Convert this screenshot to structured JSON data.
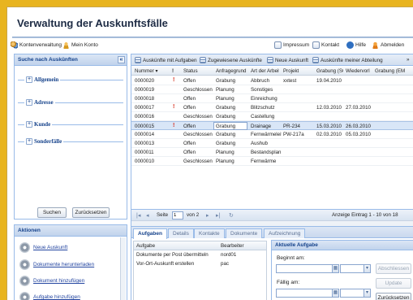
{
  "app": {
    "title": "Verwaltung der Auskunftsfälle"
  },
  "topbar": {
    "left": [
      {
        "label": "Kontenverwaltung",
        "icon": "users-icon"
      },
      {
        "label": "Mein Konto",
        "icon": "user-icon"
      }
    ],
    "right": [
      {
        "label": "Impressum",
        "icon": "document-icon"
      },
      {
        "label": "Kontakt",
        "icon": "contact-icon"
      },
      {
        "label": "Hilfe",
        "icon": "help-icon"
      },
      {
        "label": "Abmelden",
        "icon": "logout-icon"
      }
    ]
  },
  "search_panel": {
    "title": "Suche nach Auskünften",
    "collapse_glyph": "«",
    "sections": [
      {
        "label": "Allgemein",
        "toggle": "+"
      },
      {
        "label": "Adresse",
        "toggle": "+"
      },
      {
        "label": "Kunde",
        "toggle": "+"
      },
      {
        "label": "Sonderfälle",
        "toggle": "+"
      }
    ],
    "search_button": "Suchen",
    "reset_button": "Zurücksetzen"
  },
  "actions_panel": {
    "title": "Aktionen",
    "items": [
      "Neue Auskunft",
      "Dokumente herunterladen",
      "Dokument hinzufügen",
      "Aufgabe hinzufügen"
    ]
  },
  "grid_toolbar": {
    "items": [
      "Auskünfte mit Aufgaben",
      "Zugewiesene Auskünfte",
      "Neue Auskunft",
      "Auskünfte meiner Abteilung"
    ],
    "overflow_glyph": "»"
  },
  "grid": {
    "columns": [
      "Nummer ▾",
      "!",
      "Status",
      "Anfragegrund",
      "Art der Arbeit",
      "Projekt",
      "Grabung (SO",
      "Wiedervorl",
      "Grabung (EM"
    ],
    "rows": [
      {
        "nummer": "0000020",
        "flag": "!",
        "status": "Offen",
        "grund": "Grabung",
        "art": "Abbruch",
        "projekt": "xxtest",
        "grabung_so": "19.04.2010",
        "wiedervorl": ""
      },
      {
        "nummer": "0000019",
        "flag": "",
        "status": "Geschlossen",
        "grund": "Planung",
        "art": "Sonstiges",
        "projekt": "",
        "grabung_so": "",
        "wiedervorl": ""
      },
      {
        "nummer": "0000018",
        "flag": "",
        "status": "Offen",
        "grund": "Planung",
        "art": "Einreichung",
        "projekt": "",
        "grabung_so": "",
        "wiedervorl": ""
      },
      {
        "nummer": "0000017",
        "flag": "!",
        "status": "Offen",
        "grund": "Grabung",
        "art": "Blitzschutz",
        "projekt": "",
        "grabung_so": "12.03.2010",
        "wiedervorl": "27.03.2010"
      },
      {
        "nummer": "0000016",
        "flag": "",
        "status": "Geschlossen",
        "grund": "Grabung",
        "art": "Castellung",
        "projekt": "",
        "grabung_so": "",
        "wiedervorl": ""
      },
      {
        "nummer": "0000015",
        "flag": "!",
        "status": "Offen",
        "grund": "Grabung",
        "art": "Drainage",
        "projekt": "PR-234",
        "grabung_so": "15.03.2010",
        "wiedervorl": "26.03.2010"
      },
      {
        "nummer": "0000014",
        "flag": "",
        "status": "Geschlossen",
        "grund": "Grabung",
        "art": "Fernwärmeleitung",
        "projekt": "PW-217a",
        "grabung_so": "02.03.2010",
        "wiedervorl": "05.03.2010"
      },
      {
        "nummer": "0000013",
        "flag": "",
        "status": "Offen",
        "grund": "Grabung",
        "art": "Aushub",
        "projekt": "",
        "grabung_so": "",
        "wiedervorl": ""
      },
      {
        "nummer": "0000011",
        "flag": "",
        "status": "Offen",
        "grund": "Planung",
        "art": "Bestandsplan",
        "projekt": "",
        "grabung_so": "",
        "wiedervorl": ""
      },
      {
        "nummer": "0000010",
        "flag": "",
        "status": "Geschlossen",
        "grund": "Planung",
        "art": "Fernwärme",
        "projekt": "",
        "grabung_so": "",
        "wiedervorl": ""
      }
    ],
    "pager": {
      "first": "|◂",
      "prev": "◂",
      "page_label": "Seite",
      "page_value": "1",
      "of_label": "von 2",
      "next": "▸",
      "last": "▸|",
      "refresh": "↻",
      "summary": "Anzeige Eintrag 1 - 10 von 18"
    }
  },
  "detail": {
    "tabs": [
      "Aufgaben",
      "Details",
      "Kontakte",
      "Dokumente",
      "Aufzeichnung"
    ],
    "active_tab": 0,
    "tasks": {
      "columns": [
        "Aufgabe",
        "Bearbeiter"
      ],
      "rows": [
        {
          "aufgabe": "Dokumente per Post übermitteln",
          "bearbeiter": "nord01"
        },
        {
          "aufgabe": "Vor-Ort-Auskunft erstellen",
          "bearbeiter": "pac"
        }
      ]
    },
    "current_task": {
      "title": "Aktuelle Aufgabe",
      "begonnen_label": "Beginnt am:",
      "faellig_label": "Fällig am:",
      "abschliessen": "Abschliessen",
      "update": "Update",
      "reset": "Zurücksetzen"
    }
  }
}
